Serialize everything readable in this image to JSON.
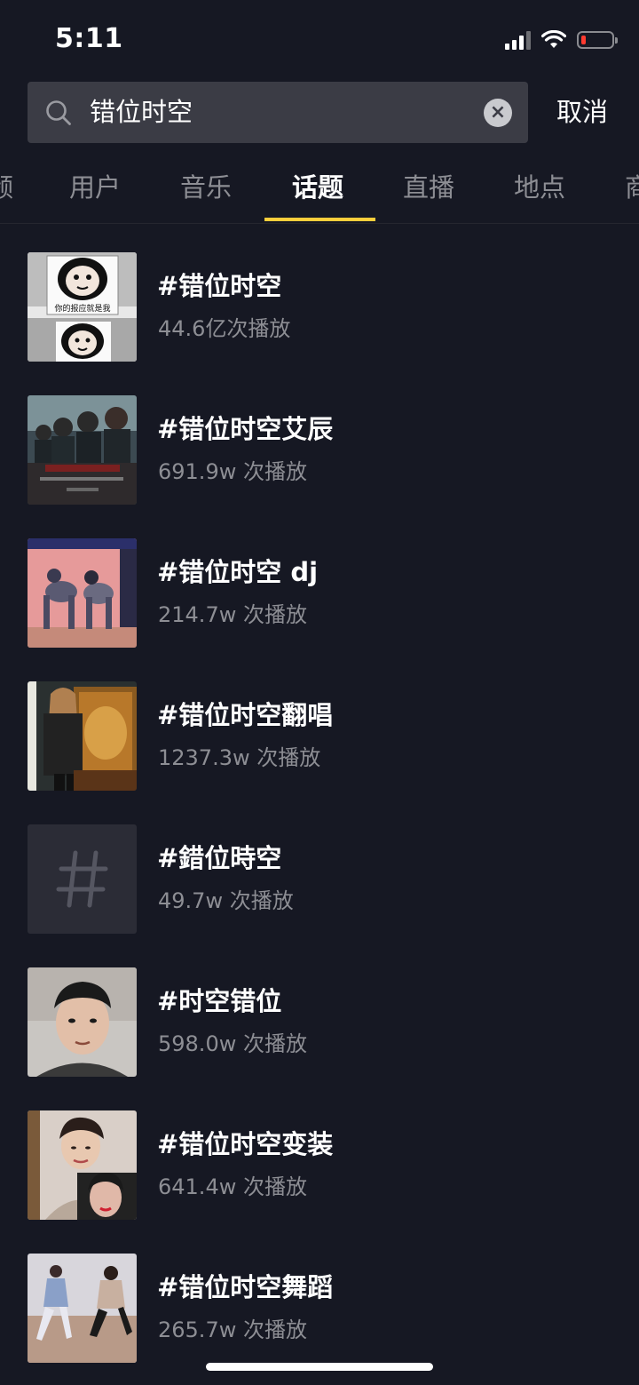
{
  "status_bar": {
    "time": "5:11",
    "battery_level": 0.15
  },
  "search": {
    "query": "错位时空",
    "cancel_label": "取消"
  },
  "tabs": [
    {
      "label": "频",
      "active": false
    },
    {
      "label": "用户",
      "active": false
    },
    {
      "label": "音乐",
      "active": false
    },
    {
      "label": "话题",
      "active": true
    },
    {
      "label": "直播",
      "active": false
    },
    {
      "label": "地点",
      "active": false
    },
    {
      "label": "商",
      "active": false
    }
  ],
  "topics": [
    {
      "title": "#错位时空",
      "plays": "44.6亿次播放",
      "thumb": "panda-meme",
      "thumb_caption": "你的报应就是我"
    },
    {
      "title": "#错位时空艾辰",
      "plays": "691.9w 次播放",
      "thumb": "anime-classroom"
    },
    {
      "title": "#错位时空 dj",
      "plays": "214.7w 次播放",
      "thumb": "dance-pink-room"
    },
    {
      "title": "#错位时空翻唱",
      "plays": "1237.3w 次播放",
      "thumb": "singer-painting"
    },
    {
      "title": "#錯位時空",
      "plays": "49.7w 次播放",
      "thumb": "hashtag-icon"
    },
    {
      "title": "#时空错位",
      "plays": "598.0w 次播放",
      "thumb": "selfie-boy"
    },
    {
      "title": "#错位时空变装",
      "plays": "641.4w 次播放",
      "thumb": "makeup-girl"
    },
    {
      "title": "#错位时空舞蹈",
      "plays": "265.7w 次播放",
      "thumb": "dance-studio"
    }
  ]
}
